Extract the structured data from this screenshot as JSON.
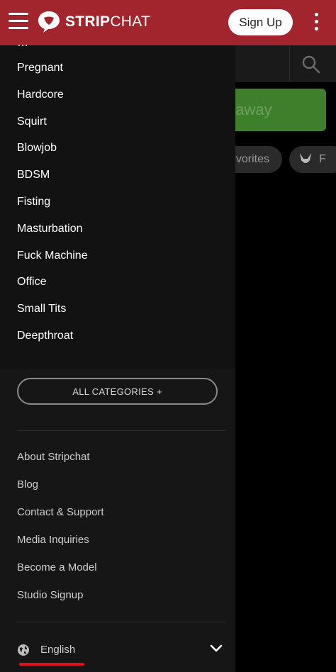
{
  "header": {
    "logo_text_bold": "STRIP",
    "logo_text_light": "CHAT",
    "signup_label": "Sign Up"
  },
  "background": {
    "giveaway_text": "eaway",
    "favorites_text": "vorites",
    "f_text": "F"
  },
  "drawer": {
    "categories": [
      "Pregnant",
      "Hardcore",
      "Squirt",
      "Blowjob",
      "BDSM",
      "Fisting",
      "Masturbation",
      "Fuck Machine",
      "Office",
      "Small Tits",
      "Deepthroat"
    ],
    "all_categories_label": "ALL CATEGORIES +",
    "footer_links": [
      "About Stripchat",
      "Blog",
      "Contact & Support",
      "Media Inquiries",
      "Become a Model",
      "Studio Signup"
    ],
    "language": "English"
  },
  "colors": {
    "brand": "#a2252d",
    "drawer_bg": "#161616",
    "accent_underline": "#e0101a",
    "giveaway_green": "#3f7f2c"
  },
  "icons": [
    "hamburger-icon",
    "stripchat-logo-icon",
    "more-vertical-icon",
    "search-icon",
    "bunny-icon",
    "globe-icon",
    "chevron-down-icon"
  ]
}
